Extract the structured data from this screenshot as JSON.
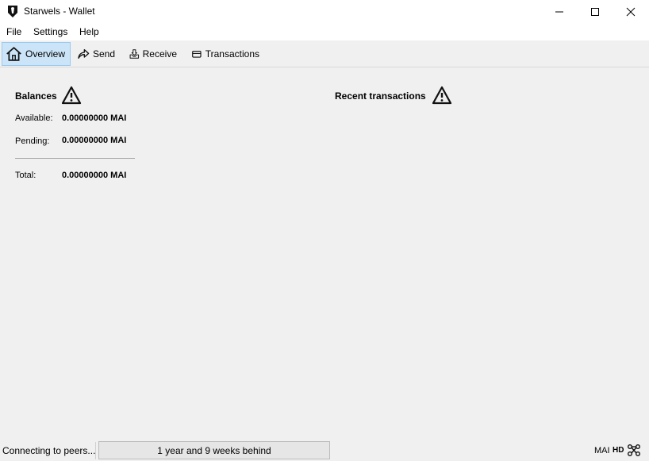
{
  "window": {
    "title": "Starwels - Wallet",
    "icons": {
      "app": "starwels-app-icon",
      "minimize": "minimize-icon",
      "maximize": "maximize-icon",
      "close": "close-icon"
    }
  },
  "menu": {
    "items": [
      {
        "label": "File"
      },
      {
        "label": "Settings"
      },
      {
        "label": "Help"
      }
    ]
  },
  "toolbar": {
    "tabs": [
      {
        "label": "Overview",
        "icon": "home-icon",
        "active": true
      },
      {
        "label": "Send",
        "icon": "send-arrow-icon",
        "active": false
      },
      {
        "label": "Receive",
        "icon": "receive-inbox-icon",
        "active": false
      },
      {
        "label": "Transactions",
        "icon": "transactions-card-icon",
        "active": false
      }
    ],
    "active_color": "#cce4f7"
  },
  "balances": {
    "title": "Balances",
    "available_label": "Available:",
    "available_value": "0.00000000 MAI",
    "pending_label": "Pending:",
    "pending_value": "0.00000000 MAI",
    "total_label": "Total:",
    "total_value": "0.00000000 MAI",
    "warning_icon": "warning-icon"
  },
  "recent": {
    "title": "Recent transactions",
    "warning_icon": "warning-icon"
  },
  "status": {
    "text": "Connecting to peers...",
    "progress_text": "1 year and 9 weeks behind",
    "unit": "MAI",
    "hd": "HD",
    "network_icon": "network-icon"
  }
}
